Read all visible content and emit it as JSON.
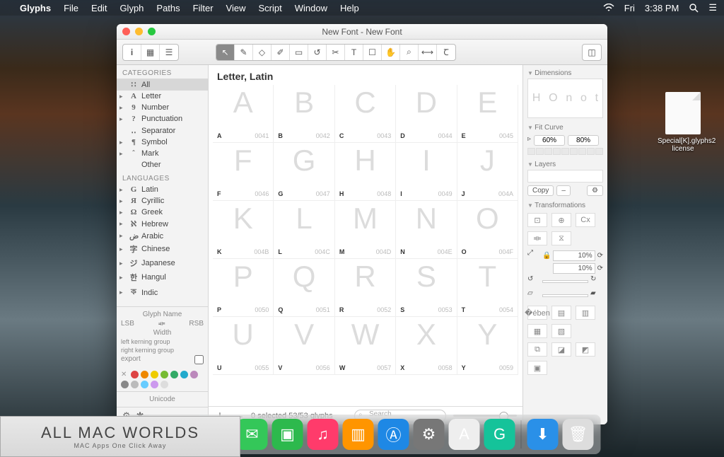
{
  "menubar": {
    "apple": "",
    "app": "Glyphs",
    "items": [
      "File",
      "Edit",
      "Glyph",
      "Paths",
      "Filter",
      "View",
      "Script",
      "Window",
      "Help"
    ],
    "wifi": "⧋",
    "day": "Fri",
    "time": "3:38 PM"
  },
  "desktop": {
    "file_label": "Special[K].glyphs2 license"
  },
  "window": {
    "title": "New Font - New Font"
  },
  "sidebar": {
    "categories_header": "CATEGORIES",
    "categories": [
      {
        "icon": "∷",
        "label": "All",
        "selected": true,
        "arrow": false
      },
      {
        "icon": "A",
        "label": "Letter",
        "arrow": true
      },
      {
        "icon": "9",
        "label": "Number",
        "arrow": true
      },
      {
        "icon": "?",
        "label": "Punctuation",
        "arrow": true
      },
      {
        "icon": "‥",
        "label": "Separator",
        "arrow": false
      },
      {
        "icon": "¶",
        "label": "Symbol",
        "arrow": true
      },
      {
        "icon": "ˆ",
        "label": "Mark",
        "arrow": true
      },
      {
        "icon": "",
        "label": "Other",
        "arrow": false
      }
    ],
    "languages_header": "LANGUAGES",
    "languages": [
      {
        "icon": "G",
        "label": "Latin"
      },
      {
        "icon": "Я",
        "label": "Cyrillic"
      },
      {
        "icon": "Ω",
        "label": "Greek"
      },
      {
        "icon": "ℵ",
        "label": "Hebrew"
      },
      {
        "icon": "ض",
        "label": "Arabic"
      },
      {
        "icon": "字",
        "label": "Chinese"
      },
      {
        "icon": "ジ",
        "label": "Japanese"
      },
      {
        "icon": "한",
        "label": "Hangul"
      },
      {
        "icon": "ক",
        "label": "Indic"
      }
    ],
    "info": {
      "glyph_name": "Glyph Name",
      "lsb": "LSB",
      "rsb": "RSB",
      "width": "Width",
      "left_kern": "left kerning group",
      "right_kern": "right kerning group",
      "export": "export",
      "unicode": "Unicode"
    },
    "colors": [
      "#d44",
      "#e80",
      "#ec0",
      "#7b3",
      "#3a6",
      "#2ac",
      "#b8b",
      "#888",
      "#bbb",
      "#6cf",
      "#c9e",
      "#ddd"
    ]
  },
  "main": {
    "heading": "Letter, Latin",
    "glyphs": [
      [
        {
          "l": "A",
          "c": "0041"
        },
        {
          "l": "B",
          "c": "0042"
        },
        {
          "l": "C",
          "c": "0043"
        },
        {
          "l": "D",
          "c": "0044"
        },
        {
          "l": "E",
          "c": "0045"
        }
      ],
      [
        {
          "l": "F",
          "c": "0046"
        },
        {
          "l": "G",
          "c": "0047"
        },
        {
          "l": "H",
          "c": "0048"
        },
        {
          "l": "I",
          "c": "0049"
        },
        {
          "l": "J",
          "c": "004A"
        }
      ],
      [
        {
          "l": "K",
          "c": "004B"
        },
        {
          "l": "L",
          "c": "004C"
        },
        {
          "l": "M",
          "c": "004D"
        },
        {
          "l": "N",
          "c": "004E"
        },
        {
          "l": "O",
          "c": "004F"
        }
      ],
      [
        {
          "l": "P",
          "c": "0050"
        },
        {
          "l": "Q",
          "c": "0051"
        },
        {
          "l": "R",
          "c": "0052"
        },
        {
          "l": "S",
          "c": "0053"
        },
        {
          "l": "T",
          "c": "0054"
        }
      ],
      [
        {
          "l": "U",
          "c": "0055"
        },
        {
          "l": "V",
          "c": "0056"
        },
        {
          "l": "W",
          "c": "0057"
        },
        {
          "l": "X",
          "c": "0058"
        },
        {
          "l": "Y",
          "c": "0059"
        }
      ]
    ],
    "footer": {
      "status": "0 selected 53/53 glyphs",
      "search_placeholder": "Search"
    }
  },
  "rpanel": {
    "dimensions": "Dimensions",
    "dim_sample": [
      "H",
      "O",
      "n",
      "o",
      "t"
    ],
    "fit_curve": "Fit Curve",
    "fc_low": "60%",
    "fc_high": "80%",
    "layers": "Layers",
    "copy": "Copy",
    "transformations": "Transformations",
    "pct": "10%"
  },
  "dock": {
    "apps": [
      {
        "name": "finder",
        "bg": "#3aa0ff",
        "glyph": "☺"
      },
      {
        "name": "photos",
        "bg": "#fff",
        "glyph": "✿"
      },
      {
        "name": "safari",
        "bg": "#2a90e8",
        "glyph": "◎"
      },
      {
        "name": "messages",
        "bg": "#34c759",
        "glyph": "✉"
      },
      {
        "name": "facetime",
        "bg": "#2db94d",
        "glyph": "▣"
      },
      {
        "name": "itunes",
        "bg": "#ff3b6b",
        "glyph": "♫"
      },
      {
        "name": "ibooks",
        "bg": "#ff9500",
        "glyph": "▥"
      },
      {
        "name": "appstore",
        "bg": "#1e88e5",
        "glyph": "Ⓐ"
      },
      {
        "name": "settings",
        "bg": "#777",
        "glyph": "⚙"
      },
      {
        "name": "glyphs",
        "bg": "#eee",
        "glyph": "A"
      },
      {
        "name": "grammarly",
        "bg": "#15c39a",
        "glyph": "G"
      }
    ],
    "tray": [
      {
        "name": "downloads",
        "bg": "#2a90e8",
        "glyph": "⬇"
      },
      {
        "name": "trash",
        "bg": "#ddd",
        "glyph": "🗑"
      }
    ]
  },
  "banner": {
    "line1": "ALL MAC WORLDS",
    "line2": "MAC Apps One Click Away"
  }
}
